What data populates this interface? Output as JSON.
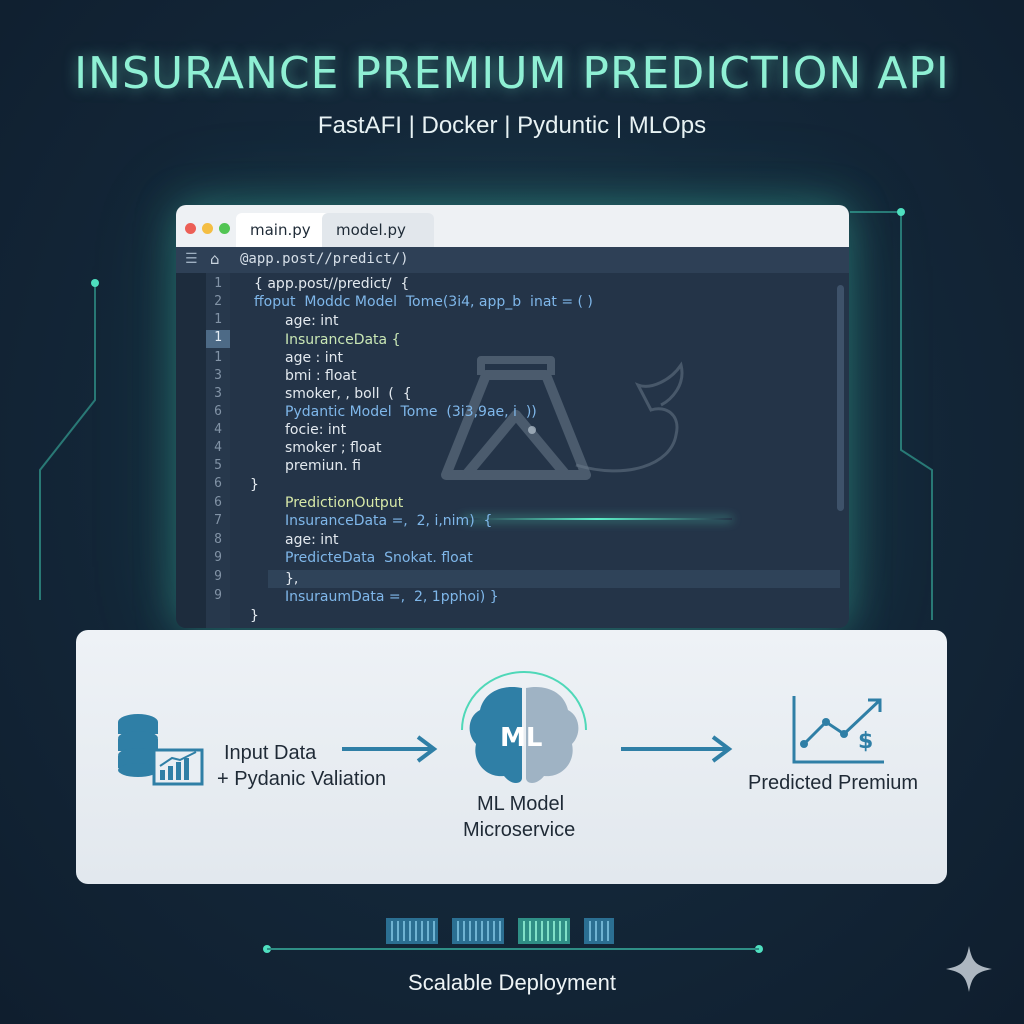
{
  "header": {
    "title": "INSURANCE PREMIUM PREDICTION API",
    "subtitle": "FastAFI | Docker | Pyduntic | MLOps"
  },
  "editor": {
    "tabs": [
      "main.py",
      "model.py"
    ],
    "address": "@app.post//predict/)",
    "line_numbers": [
      "1",
      "2",
      "1",
      "1",
      "1",
      "3",
      "3",
      "6",
      "4",
      "4",
      "5",
      "6",
      "6",
      "7",
      "8",
      "9",
      "9",
      "9"
    ],
    "highlighted_line_index": 4,
    "code_lines": [
      "{ app.post//predict/  {",
      "ffoput  Moddc Model  Tome(3i4, app_b  inat = ( )",
      "age: int",
      "InsuranceData {",
      "age : int",
      "bmi : float",
      "smoker, , boll  (  {",
      "Pydantic Model  Tome  (3i3,9ae, i  ))",
      "focie: int",
      "smoker ; float",
      "premiun. fi",
      "}",
      "PredictionOutput",
      "InsuranceData =,  2, i,nim)  {",
      "age: int",
      "PredicteData  Snokat. float",
      "},",
      "InsuraumData =,  2, 1pphoi) }",
      "}"
    ]
  },
  "flow": {
    "input_line1": "Input Data",
    "input_line2": "+ Pydanic Valiation",
    "model_badge": "ML",
    "model_line1": "ML Model",
    "model_line2": "Microservice",
    "output_label": "Predicted Premium",
    "currency_symbol": "$"
  },
  "footer": {
    "deploy_label": "Scalable Deployment",
    "container_count": 4
  },
  "colors": {
    "accent": "#8ff0d4",
    "icon_blue": "#2f7fa6",
    "panel_bg": "#e9eef3",
    "editor_bg": "#243448"
  }
}
